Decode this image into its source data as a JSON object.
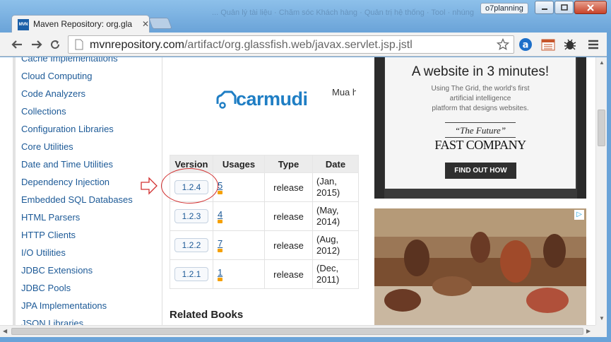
{
  "window": {
    "tab_title": "Maven Repository: org.gla",
    "tab_favicon": "MVN",
    "blurred_title": "... Quản lý tài liệu · Chăm sóc Khách hàng · Quản trị hệ thống · Tool · nhúng",
    "profile_badge": "o7planning"
  },
  "toolbar": {
    "url_host": "mvnrepository.com",
    "url_path": "/artifact/org.glassfish.web/javax.servlet.jsp.jstl"
  },
  "sidebar": {
    "items": [
      "Cache Implementations",
      "Cloud Computing",
      "Code Analyzers",
      "Collections",
      "Configuration Libraries",
      "Core Utilities",
      "Date and Time Utilities",
      "Dependency Injection",
      "Embedded SQL Databases",
      "HTML Parsers",
      "HTTP Clients",
      "I/O Utilities",
      "JDBC Extensions",
      "JDBC Pools",
      "JPA Implementations",
      "JSON Libraries"
    ]
  },
  "banner": {
    "logo_text": "carmudi",
    "side_text": "Mua hoặc"
  },
  "versions": {
    "headers": [
      "Version",
      "Usages",
      "Type",
      "Date"
    ],
    "rows": [
      {
        "version": "1.2.4",
        "usages": "5",
        "type": "release",
        "date_line1": "(Jan,",
        "date_line2": "2015)"
      },
      {
        "version": "1.2.3",
        "usages": "4",
        "type": "release",
        "date_line1": "(May,",
        "date_line2": "2014)"
      },
      {
        "version": "1.2.2",
        "usages": "7",
        "type": "release",
        "date_line1": "(Aug,",
        "date_line2": "2012)"
      },
      {
        "version": "1.2.1",
        "usages": "1",
        "type": "release",
        "date_line1": "(Dec,",
        "date_line2": "2011)"
      }
    ]
  },
  "related_books": "Related Books",
  "ad1": {
    "headline": "A website in 3 minutes!",
    "sub_line1": "Using The Grid, the world's first",
    "sub_line2": "artificial intelligence",
    "sub_line3": "platform that designs websites.",
    "quote": "“The Future”",
    "brand": "FAST COMPANY",
    "cta": "FIND OUT HOW"
  },
  "colors": {
    "link": "#1d5a97",
    "usage_bar": "#f5a000",
    "annotation": "#d23030",
    "brand_blue": "#1f7ec4"
  }
}
